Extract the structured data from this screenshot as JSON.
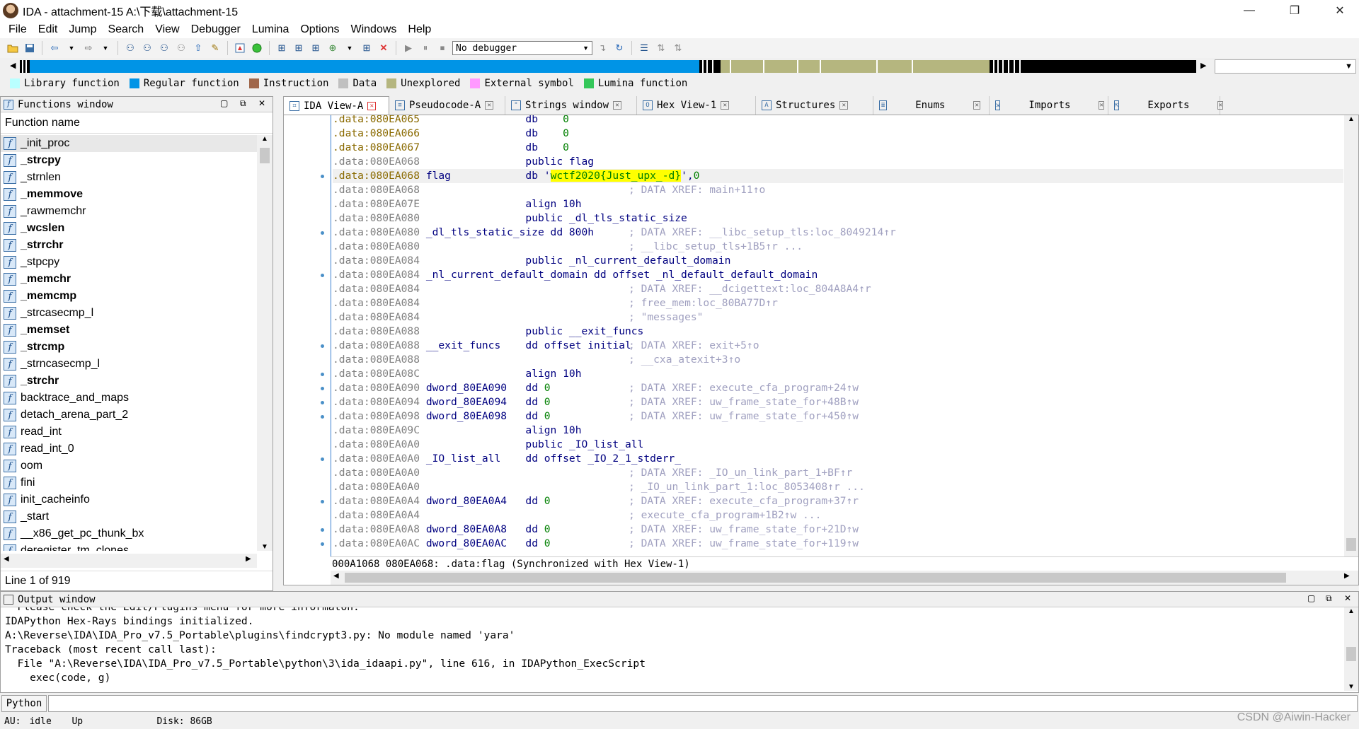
{
  "window": {
    "title": "IDA - attachment-15 A:\\下载\\attachment-15",
    "minimize": "—",
    "maximize": "❐",
    "close": "✕"
  },
  "menu": [
    "File",
    "Edit",
    "Jump",
    "Search",
    "View",
    "Debugger",
    "Lumina",
    "Options",
    "Windows",
    "Help"
  ],
  "toolbar": {
    "debugger_value": "No debugger"
  },
  "legend": [
    {
      "label": "Library function",
      "color": "#b9ffff"
    },
    {
      "label": "Regular function",
      "color": "#0094e6"
    },
    {
      "label": "Instruction",
      "color": "#a0674b"
    },
    {
      "label": "Data",
      "color": "#c0c0c0"
    },
    {
      "label": "Unexplored",
      "color": "#b5b67f"
    },
    {
      "label": "External symbol",
      "color": "#ff99ff"
    },
    {
      "label": "Lumina function",
      "color": "#34c759"
    }
  ],
  "functions_window": {
    "title": "Functions window",
    "column_header": "Function name",
    "status": "Line 1 of 919",
    "functions": [
      {
        "name": "_init_proc",
        "bold": false
      },
      {
        "name": "_strcpy",
        "bold": true
      },
      {
        "name": "_strnlen",
        "bold": false
      },
      {
        "name": "_memmove",
        "bold": true
      },
      {
        "name": "_rawmemchr",
        "bold": false
      },
      {
        "name": "_wcslen",
        "bold": true
      },
      {
        "name": "_strrchr",
        "bold": true
      },
      {
        "name": "_stpcpy",
        "bold": false
      },
      {
        "name": "_memchr",
        "bold": true
      },
      {
        "name": "_memcmp",
        "bold": true
      },
      {
        "name": "_strcasecmp_l",
        "bold": false
      },
      {
        "name": "_memset",
        "bold": true
      },
      {
        "name": "_strcmp",
        "bold": true
      },
      {
        "name": "_strncasecmp_l",
        "bold": false
      },
      {
        "name": "_strchr",
        "bold": true
      },
      {
        "name": "backtrace_and_maps",
        "bold": false
      },
      {
        "name": "detach_arena_part_2",
        "bold": false
      },
      {
        "name": "read_int",
        "bold": false
      },
      {
        "name": "read_int_0",
        "bold": false
      },
      {
        "name": "oom",
        "bold": false
      },
      {
        "name": "fini",
        "bold": false
      },
      {
        "name": "init_cacheinfo",
        "bold": false
      },
      {
        "name": "_start",
        "bold": false
      },
      {
        "name": "__x86_get_pc_thunk_bx",
        "bold": false
      },
      {
        "name": "deregister_tm_clones",
        "bold": false
      }
    ]
  },
  "tabs": [
    {
      "label": "IDA View-A",
      "icon": "graph",
      "active": true
    },
    {
      "label": "Pseudocode-A",
      "icon": "doc",
      "active": false
    },
    {
      "label": "Strings window",
      "icon": "str",
      "active": false
    },
    {
      "label": "Hex View-1",
      "icon": "hex",
      "active": false
    },
    {
      "label": "Structures",
      "icon": "A",
      "active": false
    },
    {
      "label": "Enums",
      "icon": "en",
      "active": false
    },
    {
      "label": "Imports",
      "icon": "im",
      "active": false
    },
    {
      "label": "Exports",
      "icon": "ex",
      "active": false
    }
  ],
  "ida_view": {
    "status": "000A1068 080EA068: .data:flag (Synchronized with Hex View-1)",
    "lines": [
      {
        "addr": ".data:080EA065",
        "dim": false,
        "dot": false,
        "name": "",
        "op": "db",
        "arg": "    0",
        "argcls": "num",
        "cmt": ""
      },
      {
        "addr": ".data:080EA066",
        "dim": false,
        "dot": false,
        "name": "",
        "op": "db",
        "arg": "    0",
        "argcls": "num",
        "cmt": ""
      },
      {
        "addr": ".data:080EA067",
        "dim": false,
        "dot": false,
        "name": "",
        "op": "db",
        "arg": "    0",
        "argcls": "num",
        "cmt": ""
      },
      {
        "addr": ".data:080EA068",
        "dim": true,
        "dot": false,
        "name": "",
        "op": "public flag",
        "arg": "",
        "argcls": "",
        "cmt": ""
      },
      {
        "addr": ".data:080EA068",
        "dim": false,
        "dot": true,
        "name": "flag",
        "op": "db",
        "arg": "",
        "argcls": "str",
        "str_pre": " '",
        "str": "wctf2020{Just_upx_-d}",
        "str_post": "',",
        "str_num": "0",
        "cmt": "",
        "current": true
      },
      {
        "addr": ".data:080EA068",
        "dim": true,
        "dot": false,
        "name": "",
        "op": "",
        "arg": "",
        "argcls": "",
        "cmt": "; DATA XREF: main+11↑o"
      },
      {
        "addr": ".data:080EA07E",
        "dim": true,
        "dot": false,
        "name": "",
        "op": "align 10h",
        "arg": "",
        "argcls": "",
        "cmt": ""
      },
      {
        "addr": ".data:080EA080",
        "dim": true,
        "dot": false,
        "name": "",
        "op": "public _dl_tls_static_size",
        "arg": "",
        "argcls": "",
        "cmt": ""
      },
      {
        "addr": ".data:080EA080",
        "dim": true,
        "dot": true,
        "name": "_dl_tls_static_size dd 800h",
        "op": "",
        "arg": "",
        "argcls": "",
        "cmt": "; DATA XREF: __libc_setup_tls:loc_8049214↑r"
      },
      {
        "addr": ".data:080EA080",
        "dim": true,
        "dot": false,
        "name": "",
        "op": "",
        "arg": "",
        "argcls": "",
        "cmt": "; __libc_setup_tls+1B5↑r ..."
      },
      {
        "addr": ".data:080EA084",
        "dim": true,
        "dot": false,
        "name": "",
        "op": "public _nl_current_default_domain",
        "arg": "",
        "argcls": "",
        "cmt": ""
      },
      {
        "addr": ".data:080EA084",
        "dim": true,
        "dot": true,
        "name": "_nl_current_default_domain dd offset _nl_default_default_domain",
        "op": "",
        "arg": "",
        "argcls": "",
        "cmt": ""
      },
      {
        "addr": ".data:080EA084",
        "dim": true,
        "dot": false,
        "name": "",
        "op": "",
        "arg": "",
        "argcls": "",
        "cmt": "; DATA XREF: __dcigettext:loc_804A8A4↑r"
      },
      {
        "addr": ".data:080EA084",
        "dim": true,
        "dot": false,
        "name": "",
        "op": "",
        "arg": "",
        "argcls": "",
        "cmt": "; free_mem:loc_80BA77D↑r"
      },
      {
        "addr": ".data:080EA084",
        "dim": true,
        "dot": false,
        "name": "",
        "op": "",
        "arg": "",
        "argcls": "",
        "cmt": "; \"messages\""
      },
      {
        "addr": ".data:080EA088",
        "dim": true,
        "dot": false,
        "name": "",
        "op": "public __exit_funcs",
        "arg": "",
        "argcls": "",
        "cmt": ""
      },
      {
        "addr": ".data:080EA088",
        "dim": true,
        "dot": true,
        "name": "__exit_funcs",
        "op": "dd offset initial",
        "arg": "",
        "argcls": "",
        "cmt": "; DATA XREF: exit+5↑o"
      },
      {
        "addr": ".data:080EA088",
        "dim": true,
        "dot": false,
        "name": "",
        "op": "",
        "arg": "",
        "argcls": "",
        "cmt": "; __cxa_atexit+3↑o"
      },
      {
        "addr": ".data:080EA08C",
        "dim": true,
        "dot": true,
        "name": "",
        "op": "align 10h",
        "arg": "",
        "argcls": "",
        "cmt": ""
      },
      {
        "addr": ".data:080EA090",
        "dim": true,
        "dot": true,
        "name": "dword_80EA090",
        "op": "dd",
        "arg": " 0",
        "argcls": "num",
        "cmt": "; DATA XREF: execute_cfa_program+24↑w"
      },
      {
        "addr": ".data:080EA094",
        "dim": true,
        "dot": true,
        "name": "dword_80EA094",
        "op": "dd",
        "arg": " 0",
        "argcls": "num",
        "cmt": "; DATA XREF: uw_frame_state_for+48B↑w"
      },
      {
        "addr": ".data:080EA098",
        "dim": true,
        "dot": true,
        "name": "dword_80EA098",
        "op": "dd",
        "arg": " 0",
        "argcls": "num",
        "cmt": "; DATA XREF: uw_frame_state_for+450↑w"
      },
      {
        "addr": ".data:080EA09C",
        "dim": true,
        "dot": false,
        "name": "",
        "op": "align 10h",
        "arg": "",
        "argcls": "",
        "cmt": ""
      },
      {
        "addr": ".data:080EA0A0",
        "dim": true,
        "dot": false,
        "name": "",
        "op": "public _IO_list_all",
        "arg": "",
        "argcls": "",
        "cmt": ""
      },
      {
        "addr": ".data:080EA0A0",
        "dim": true,
        "dot": true,
        "name": "_IO_list_all",
        "op": "dd offset _IO_2_1_stderr_",
        "arg": "",
        "argcls": "",
        "cmt": ""
      },
      {
        "addr": ".data:080EA0A0",
        "dim": true,
        "dot": false,
        "name": "",
        "op": "",
        "arg": "",
        "argcls": "",
        "cmt": "; DATA XREF: _IO_un_link_part_1+BF↑r"
      },
      {
        "addr": ".data:080EA0A0",
        "dim": true,
        "dot": false,
        "name": "",
        "op": "",
        "arg": "",
        "argcls": "",
        "cmt": "; _IO_un_link_part_1:loc_8053408↑r ..."
      },
      {
        "addr": ".data:080EA0A4",
        "dim": true,
        "dot": true,
        "name": "dword_80EA0A4",
        "op": "dd",
        "arg": " 0",
        "argcls": "num",
        "cmt": "; DATA XREF: execute_cfa_program+37↑r"
      },
      {
        "addr": ".data:080EA0A4",
        "dim": true,
        "dot": false,
        "name": "",
        "op": "",
        "arg": "",
        "argcls": "",
        "cmt": "; execute_cfa_program+1B2↑w ..."
      },
      {
        "addr": ".data:080EA0A8",
        "dim": true,
        "dot": true,
        "name": "dword_80EA0A8",
        "op": "dd",
        "arg": " 0",
        "argcls": "num",
        "cmt": "; DATA XREF: uw_frame_state_for+21D↑w"
      },
      {
        "addr": ".data:080EA0AC",
        "dim": true,
        "dot": true,
        "name": "dword_80EA0AC",
        "op": "dd",
        "arg": " 0",
        "argcls": "num",
        "cmt": "; DATA XREF: uw_frame_state_for+119↑w"
      }
    ]
  },
  "output_window": {
    "title": "Output window",
    "lines": [
      "  Please check the Edit/Plugins menu for more informaton.",
      "IDAPython Hex-Rays bindings initialized.",
      "A:\\Reverse\\IDA\\IDA_Pro_v7.5_Portable\\plugins\\findcrypt3.py: No module named 'yara'",
      "Traceback (most recent call last):",
      "  File \"A:\\Reverse\\IDA\\IDA_Pro_v7.5_Portable\\python\\3\\ida_idaapi.py\", line 616, in IDAPython_ExecScript",
      "    exec(code, g)"
    ]
  },
  "python": {
    "label": "Python",
    "value": ""
  },
  "statusbar": {
    "au": "AU:",
    "state": "idle",
    "direction": "Up",
    "disk": "Disk: 86GB"
  },
  "watermark": "CSDN @Aiwin-Hacker"
}
